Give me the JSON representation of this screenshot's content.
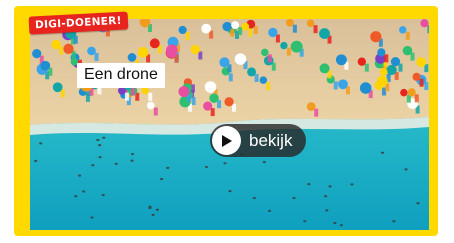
{
  "card": {
    "badge_text": "DIGI-DOENER!",
    "title": "Een drone",
    "watch_label": "bekijk",
    "play_icon": "play-icon",
    "colors": {
      "frame": "#ffd900",
      "badge": "#e8241e",
      "pill": "#2d2d2d",
      "sea": "#17b6c7",
      "sand": "#e6c89a"
    }
  }
}
